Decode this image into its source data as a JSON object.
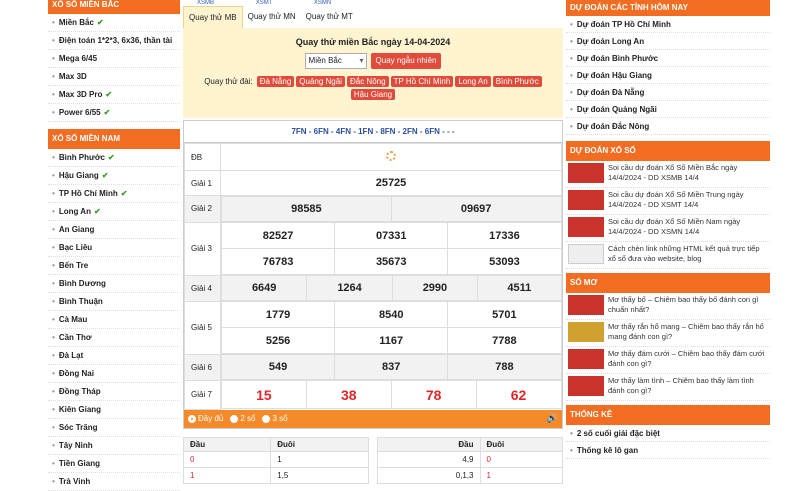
{
  "left": {
    "north_header": "Xổ số miền Bắc",
    "north_items": [
      {
        "label": "Miền Bắc",
        "check": true
      },
      {
        "label": "Điện toán 1*2*3, 6x36, thần tài",
        "check": false
      },
      {
        "label": "Mega 6/45",
        "check": false
      },
      {
        "label": "Max 3D",
        "check": false
      },
      {
        "label": "Max 3D Pro",
        "check": true
      },
      {
        "label": "Power 6/55",
        "check": true
      }
    ],
    "south_header": "Xổ số miền Nam",
    "south_items": [
      {
        "label": "Bình Phước",
        "check": true
      },
      {
        "label": "Hậu Giang",
        "check": true
      },
      {
        "label": "TP Hồ Chí Minh",
        "check": true
      },
      {
        "label": "Long An",
        "check": true
      },
      {
        "label": "An Giang",
        "check": false
      },
      {
        "label": "Bạc Liêu",
        "check": false
      },
      {
        "label": "Bến Tre",
        "check": false
      },
      {
        "label": "Bình Dương",
        "check": false
      },
      {
        "label": "Bình Thuận",
        "check": false
      },
      {
        "label": "Cà Mau",
        "check": false
      },
      {
        "label": "Cần Thơ",
        "check": false
      },
      {
        "label": "Đà Lạt",
        "check": false
      },
      {
        "label": "Đồng Nai",
        "check": false
      },
      {
        "label": "Đồng Tháp",
        "check": false
      },
      {
        "label": "Kiên Giang",
        "check": false
      },
      {
        "label": "Sóc Trăng",
        "check": false
      },
      {
        "label": "Tây Ninh",
        "check": false
      },
      {
        "label": "Tiền Giang",
        "check": false
      },
      {
        "label": "Trà Vinh",
        "check": false
      }
    ]
  },
  "top_links": [
    "XSMB",
    "XSMT",
    "XSMN"
  ],
  "tabs": [
    "Quay thử MB",
    "Quay thử MN",
    "Quay thử MT"
  ],
  "quay": {
    "title": "Quay thử miền Bắc ngày 14-04-2024",
    "select_value": "Miền Bắc",
    "random_button": "Quay ngẫu nhiên",
    "dai_label": "Quay thử đài:",
    "dai_tags": [
      "Đà Nẵng",
      "Quảng Ngãi",
      "Đắc Nông",
      "TP Hồ Chí Minh",
      "Long An",
      "Bình Phước",
      "Hậu Giang"
    ]
  },
  "results": {
    "codes": "7FN - 6FN - 4FN - 1FN - 8FN - 2FN - 6FN - - -",
    "rows": [
      {
        "label": "ĐB",
        "values": [],
        "loading": true
      },
      {
        "label": "Giải 1",
        "values": [
          "25725"
        ]
      },
      {
        "label": "Giải 2",
        "values": [
          "98585",
          "09697"
        ]
      },
      {
        "label": "Giải 3",
        "values": [
          "82527",
          "07331",
          "17336",
          "76783",
          "35673",
          "53093"
        ]
      },
      {
        "label": "Giải 4",
        "values": [
          "6649",
          "1264",
          "2990",
          "4511"
        ]
      },
      {
        "label": "Giải 5",
        "values": [
          "1779",
          "8540",
          "5701",
          "5256",
          "1167",
          "7788"
        ]
      },
      {
        "label": "Giải 6",
        "values": [
          "549",
          "837",
          "788"
        ]
      },
      {
        "label": "Giải 7",
        "values": [
          "15",
          "38",
          "78",
          "62"
        ]
      }
    ]
  },
  "options": [
    "Đầy đủ",
    "2 số",
    "3 số"
  ],
  "loto": {
    "left": {
      "headers": [
        "Đầu",
        "Đuôi"
      ],
      "rows": [
        [
          "0",
          "1"
        ],
        [
          "1",
          "1,5"
        ]
      ]
    },
    "right": {
      "headers": [
        "",
        "Đầu",
        "Đuôi"
      ],
      "rows": [
        [
          "4,9",
          "0"
        ],
        [
          "0,1,3",
          "1"
        ]
      ]
    }
  },
  "right": {
    "predict_header": "Dự đoán các tỉnh hôm nay",
    "predict_items": [
      "Dự đoán TP Hồ Chí Minh",
      "Dự đoán Long An",
      "Dự đoán Bình Phước",
      "Dự đoán Hậu Giang",
      "Dự đoán Đà Nẵng",
      "Dự đoán Quảng Ngãi",
      "Dự đoán Đắc Nông"
    ],
    "xs_header": "Dự đoán xổ số",
    "xs_items": [
      {
        "text": "Soi cầu dự đoán Xổ Số Miền Bắc ngày 14/4/2024 - DD XSMB 14/4",
        "thumb": "red"
      },
      {
        "text": "Soi cầu dự đoán Xổ Số Miền Trung ngày 14/4/2024 - DD XSMT 14/4",
        "thumb": "red"
      },
      {
        "text": "Soi cầu dự đoán Xổ Số Miền Nam ngày 14/4/2024 - DD XSMN 14/4",
        "thumb": "red"
      },
      {
        "text": "Cách chèn link những HTML kết quả trực tiếp xổ số đưa vào website, blog",
        "thumb": "white"
      }
    ],
    "dream_header": "Sổ mơ",
    "dream_items": [
      {
        "text": "Mơ thấy bố – Chiêm bao thấy bố đánh con gì chuẩn nhất?",
        "thumb": "red"
      },
      {
        "text": "Mơ thấy rắn hổ mang – Chiêm bao thấy rắn hổ mang đánh con gì?",
        "thumb": "yellow"
      },
      {
        "text": "Mơ thấy đám cưới – Chiêm bao thấy đám cưới đánh con gì?",
        "thumb": "red"
      },
      {
        "text": "Mơ thấy làm tình – Chiêm bao thấy làm tình đánh con gì?",
        "thumb": "red"
      }
    ],
    "stats_header": "Thống kê",
    "stats_items": [
      "2 số cuối giải đặc biệt",
      "Thống kê lô gan"
    ]
  }
}
